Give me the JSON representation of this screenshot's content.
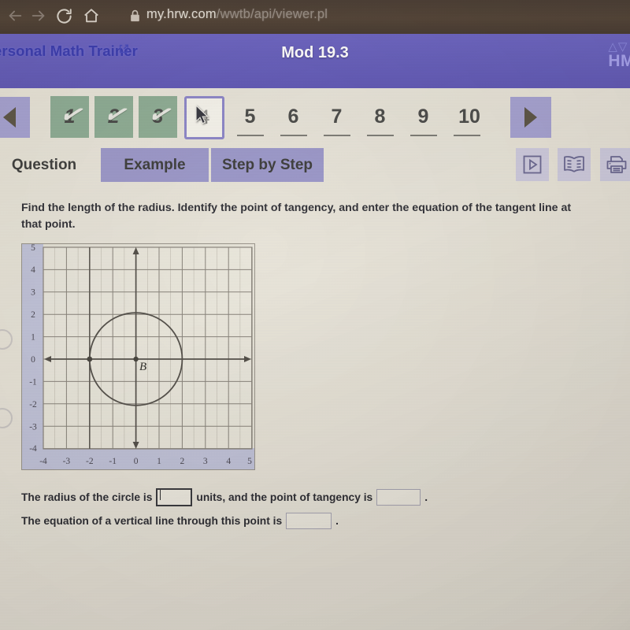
{
  "browser": {
    "back_icon": "back-arrow-icon",
    "forward_icon": "forward-arrow-icon",
    "reload_icon": "reload-icon",
    "home_icon": "home-icon",
    "lock_icon": "lock-icon",
    "url_domain": "my.hrw.com",
    "url_path": "/wwtb/api/viewer.pl"
  },
  "header": {
    "app_name": "ersonal Math Trainer",
    "external_link_icon": "external-link-icon",
    "module_title": "Mod 19.3",
    "logo_mark": "△▽",
    "logo_word": "HM",
    "bg_color": "#6961bd"
  },
  "qnav": {
    "prev_label": "◀",
    "next_label": "▶",
    "items": [
      {
        "label": "1",
        "state": "done"
      },
      {
        "label": "2",
        "state": "done"
      },
      {
        "label": "3",
        "state": "done"
      },
      {
        "label": "4",
        "state": "current"
      },
      {
        "label": "5",
        "state": "plain"
      },
      {
        "label": "6",
        "state": "plain"
      },
      {
        "label": "7",
        "state": "plain"
      },
      {
        "label": "8",
        "state": "plain"
      },
      {
        "label": "9",
        "state": "plain"
      },
      {
        "label": "10",
        "state": "plain"
      }
    ],
    "done_color": "#8fad95",
    "current_border_color": "#8e88c9"
  },
  "tabs": {
    "question": "Question",
    "example": "Example",
    "stepbystep": "Step by Step",
    "active": "Question",
    "inactive_bg": "#9d99ca"
  },
  "tools": {
    "video": "video-play-icon",
    "book": "book-icon",
    "print": "printer-icon"
  },
  "question": {
    "text": "Find the length of the radius. Identify the point of tangency, and enter the equation of the tangent line at that point."
  },
  "answers": {
    "line1_part1": "The radius of the circle is",
    "line1_part2": "units, and the point of tangency is",
    "line1_part3": ".",
    "line2_part1": "The equation of a vertical line through this point is",
    "line2_part2": ".",
    "radius_value": "",
    "radius_placeholder": "",
    "tangency_value": "",
    "equation_value": ""
  },
  "chart_data": {
    "type": "scatter",
    "title": "",
    "xlabel": "",
    "ylabel": "",
    "xlim": [
      -4,
      5
    ],
    "ylim": [
      -4,
      5
    ],
    "xticks": [
      "-4",
      "-3",
      "-2",
      "-1",
      "0",
      "1",
      "2",
      "3",
      "4",
      "5"
    ],
    "yticks": [
      "5",
      "4",
      "3",
      "2",
      "1",
      "0",
      "-1",
      "-2",
      "-3",
      "-4"
    ],
    "grid": true,
    "axis_color": "#5b5750",
    "grid_color": "#8a857c",
    "tick_label_color": "#4e4b55",
    "shapes": [
      {
        "kind": "circle",
        "name": "circle-B",
        "center": [
          0,
          0
        ],
        "radius": 2,
        "stroke": "#56524c"
      }
    ],
    "points": [
      {
        "name": "center-point-B",
        "x": 0,
        "y": 0,
        "label": "B",
        "label_dx": 0.22,
        "label_dy": -0.45
      },
      {
        "name": "tangency-point",
        "x": -2,
        "y": 0,
        "label": ""
      }
    ],
    "arrows": [
      "x-negative",
      "x-positive",
      "y-positive",
      "y-negative"
    ]
  }
}
